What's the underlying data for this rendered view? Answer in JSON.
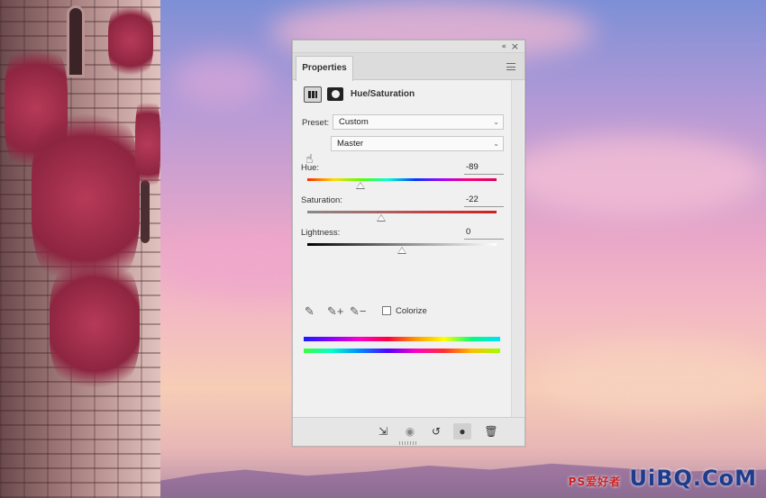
{
  "panel": {
    "tab_label": "Properties",
    "adjustment_title": "Hue/Saturation",
    "preset": {
      "label": "Preset:",
      "value": "Custom"
    },
    "channel": {
      "value": "Master"
    },
    "hue": {
      "label": "Hue:",
      "value": "-89",
      "slider_fraction": 0.28
    },
    "saturation": {
      "label": "Saturation:",
      "value": "-22",
      "slider_fraction": 0.39
    },
    "lightness": {
      "label": "Lightness:",
      "value": "0",
      "slider_fraction": 0.5
    },
    "colorize": {
      "label": "Colorize",
      "checked": false
    }
  },
  "icons": {
    "collapse": "«",
    "close": "×",
    "hand": "☝",
    "eyedropper": "✎",
    "eyedropper_add": "✎+",
    "eyedropper_subtract": "✎−",
    "clip_to_layer": "⇲",
    "view_previous": "◉",
    "reset": "↺",
    "visibility": "●",
    "trash": "🗑"
  },
  "watermark": {
    "text": "UiBQ.CoM",
    "subtext": "PS爱好者"
  }
}
